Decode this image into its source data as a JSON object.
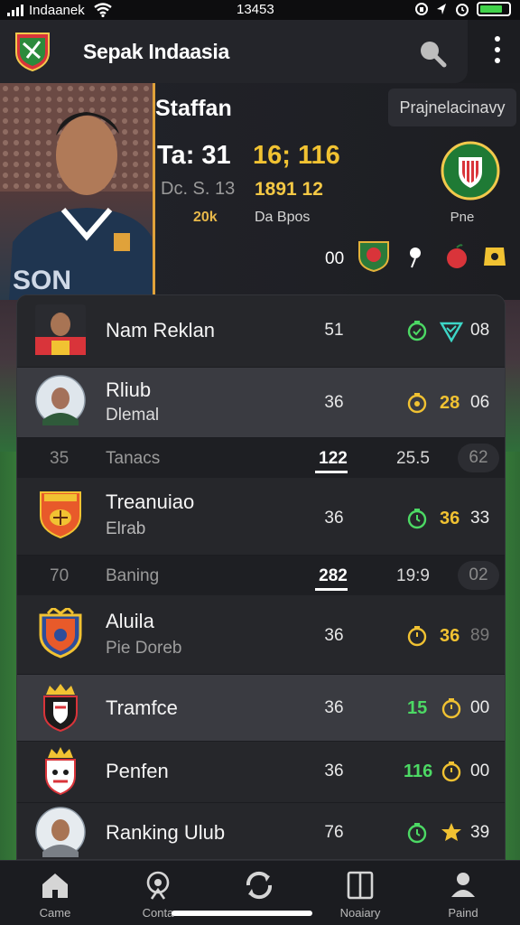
{
  "status_bar": {
    "carrier": "Indaanek",
    "time": "13453",
    "icons": [
      "signal-icon",
      "wifi-icon",
      "lock-icon",
      "location-icon",
      "alarm-icon",
      "battery-icon"
    ]
  },
  "app_bar": {
    "title": "Sepak Indaasia",
    "icons": [
      "app-logo",
      "search-icon",
      "more-vertical-icon"
    ]
  },
  "hero": {
    "player_name": "Staffan",
    "tag_label": "Prajnelacinavy",
    "stat_primary": "Ta: 31",
    "stat_highlight": "16; 116",
    "stat_secondary": "Dc. S. 13",
    "stat_secondary_value": "1891 12",
    "stat_small": "20k",
    "stat_small_label": "Da Bpos",
    "club_label": "Pne",
    "icons_value": "00",
    "icons": [
      "club-crest-icon",
      "shield-icon",
      "pin-icon",
      "apple-icon",
      "badge-icon"
    ]
  },
  "list": {
    "rows": [
      {
        "title": "Nam Reklan",
        "subtitle": "",
        "value": "51",
        "num": "",
        "end": "08",
        "avatar": "player-avatar",
        "icon1": "timer-icon",
        "icon2": "shield-check-icon",
        "num_color": "#4cd964"
      },
      {
        "title": "Rliub",
        "subtitle": "Dlemal",
        "value": "36",
        "num": "28",
        "end": "06",
        "avatar": "player-avatar",
        "icon1": "timer-icon",
        "icon2": "",
        "num_color": "#f1c232"
      },
      {
        "title": "Treanuiao",
        "subtitle": "Elrab",
        "value": "36",
        "num": "36",
        "end": "33",
        "avatar": "club-crest-icon",
        "icon1": "timer-icon",
        "icon2": "",
        "num_color": "#f1c232"
      },
      {
        "title": "Aluila",
        "subtitle": "Pie Doreb",
        "value": "36",
        "num": "36",
        "end": "89",
        "avatar": "club-crest-icon",
        "icon1": "timer-icon",
        "icon2": "",
        "num_color": "#f1c232"
      },
      {
        "title": "Tramfce",
        "subtitle": "",
        "value": "36",
        "num": "15",
        "end": "00",
        "avatar": "crown-crest-icon",
        "icon1": "",
        "icon2": "timer-icon",
        "num_color": "#4cd964"
      },
      {
        "title": "Penfen",
        "subtitle": "",
        "value": "36",
        "num": "116",
        "end": "00",
        "avatar": "crown-crest-icon",
        "icon1": "",
        "icon2": "timer-icon",
        "num_color": "#4cd964"
      },
      {
        "title": "Ranking Ulub",
        "subtitle": "",
        "value": "76",
        "num": "",
        "end": "39",
        "avatar": "player-avatar",
        "icon1": "timer-icon",
        "icon2": "star-badge-icon",
        "num_color": "#f1c232"
      }
    ],
    "subrows": [
      {
        "a": "35",
        "b": "Tanacs",
        "c": "122",
        "d": "25.5",
        "e": "62"
      },
      {
        "a": "70",
        "b": "Baning",
        "c": "282",
        "d": "19:9",
        "e": "02"
      }
    ]
  },
  "bottom_nav": {
    "items": [
      {
        "label": "Came",
        "icon": "home-icon"
      },
      {
        "label": "Conta",
        "icon": "podcast-icon"
      },
      {
        "label": "",
        "icon": "refresh-icon"
      },
      {
        "label": "Noaiary",
        "icon": "book-icon"
      },
      {
        "label": "Paind",
        "icon": "profile-icon"
      }
    ]
  }
}
